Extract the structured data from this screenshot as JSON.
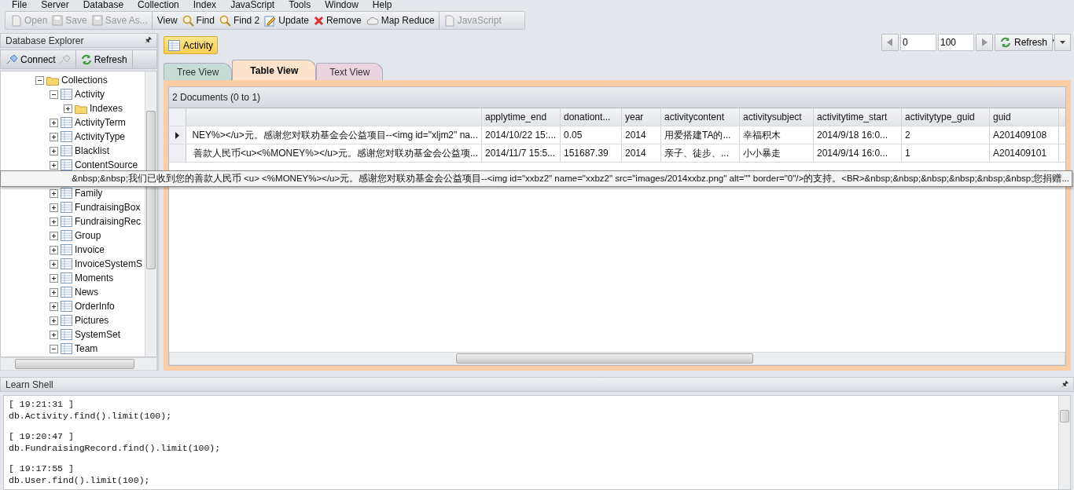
{
  "menu": [
    "File",
    "Server",
    "Database",
    "Collection",
    "Index",
    "JavaScript",
    "Tools",
    "Window",
    "Help"
  ],
  "toolbar": [
    {
      "label": "Open",
      "kind": "page",
      "disabled": true,
      "separator": false
    },
    {
      "label": "Save",
      "kind": "disk",
      "disabled": true,
      "separator": false
    },
    {
      "label": "Save As...",
      "kind": "disk",
      "disabled": true,
      "separator": false
    },
    {
      "label": "View",
      "kind": "text",
      "disabled": false,
      "separator": true
    },
    {
      "label": "Find",
      "kind": "search",
      "disabled": false,
      "separator": false
    },
    {
      "label": "Find 2",
      "kind": "search",
      "disabled": false,
      "separator": false
    },
    {
      "label": "Update",
      "kind": "edit",
      "disabled": false,
      "separator": false
    },
    {
      "label": "Remove",
      "kind": "cross",
      "disabled": false,
      "separator": false
    },
    {
      "label": "Map Reduce",
      "kind": "cloud",
      "disabled": false,
      "separator": false
    },
    {
      "label": "JavaScript",
      "kind": "page",
      "disabled": true,
      "separator": true
    }
  ],
  "explorer": {
    "title": "Database Explorer",
    "pin": "🖈",
    "connect": "Connect",
    "refresh": "Refresh",
    "tree": [
      {
        "label": "Collections",
        "kind": "folder",
        "expanded": true,
        "children": [
          {
            "label": "Activity",
            "kind": "table",
            "expanded": true,
            "children": [
              {
                "label": "Indexes",
                "kind": "folder",
                "expanded": false
              }
            ]
          },
          {
            "label": "ActivityTerm",
            "kind": "table",
            "expanded": false
          },
          {
            "label": "ActivityType",
            "kind": "table",
            "expanded": false
          },
          {
            "label": "Blacklist",
            "kind": "table",
            "expanded": false
          },
          {
            "label": "ContentSource",
            "kind": "table",
            "expanded": false
          },
          {
            "kind": "covered"
          },
          {
            "label": "Family",
            "kind": "table",
            "expanded": false
          },
          {
            "label": "FundraisingBox",
            "kind": "table",
            "expanded": false
          },
          {
            "label": "FundraisingRec",
            "kind": "table",
            "expanded": false
          },
          {
            "label": "Group",
            "kind": "table",
            "expanded": false
          },
          {
            "label": "Invoice",
            "kind": "table",
            "expanded": false
          },
          {
            "label": "InvoiceSystemS",
            "kind": "table",
            "expanded": false
          },
          {
            "label": "Moments",
            "kind": "table",
            "expanded": false
          },
          {
            "label": "News",
            "kind": "table",
            "expanded": false
          },
          {
            "label": "OrderInfo",
            "kind": "table",
            "expanded": false
          },
          {
            "label": "Pictures",
            "kind": "table",
            "expanded": false
          },
          {
            "label": "SystemSet",
            "kind": "table",
            "expanded": false
          },
          {
            "label": "Team",
            "kind": "table",
            "expanded": true
          }
        ]
      }
    ]
  },
  "document_tab": {
    "label": "Activity"
  },
  "view_tabs": [
    {
      "label": "Tree View",
      "selected": false,
      "color": "#c5ddd5"
    },
    {
      "label": "Table View",
      "selected": true,
      "color": "#fde3cc"
    },
    {
      "label": "Text View",
      "selected": false,
      "color": "#ecd3e0"
    }
  ],
  "paging": {
    "skip": "0",
    "limit": "100",
    "refresh": "Refresh"
  },
  "table": {
    "caption": "2 Documents (0 to 1)",
    "columns": [
      "",
      "applytime_end",
      "donationt...",
      "year",
      "activitycontent",
      "activitysubject",
      "activitytime_start",
      "activitytype_guid",
      "guid"
    ],
    "rows": [
      {
        "selected": true,
        "cells": [
          "NEY%></u>元。感谢您对联劝基金会公益项目--<img id=\"xljm2\" na...",
          "2014/10/22 15:...",
          "0.05",
          "2014",
          "用爱搭建TA的...",
          "幸福积木",
          "2014/9/18 16:0...",
          "2",
          "A201409108"
        ]
      },
      {
        "selected": false,
        "cells": [
          "善款人民币<u><%MONEY%></u>元。感谢您对联劝基金会公益项...",
          "2014/11/7 15:5...",
          "151687.39",
          "2014",
          "亲子、徒步、...",
          "小小暴走",
          "2014/9/14 16:0...",
          "1",
          "A201409101"
        ]
      }
    ]
  },
  "tooltip": "&nbsp;&nbsp;我们已收到您的善款人民币 <u> <%MONEY%></u>元。感谢您对联劝基金会公益项目--<img id=\"xxbz2\" name=\"xxbz2\" src=\"images/2014xxbz.png\" alt=\"\" border=\"0\"/>的支持。<BR>&nbsp;&nbsp;&nbsp;&nbsp;&nbsp;&nbsp;您捐赠...",
  "shell": {
    "title": "Learn Shell",
    "entries": [
      {
        "time": "[ 19:21:31 ]",
        "command": "db.Activity.find().limit(100);"
      },
      {
        "time": "[ 19:20:47 ]",
        "command": "db.FundraisingRecord.find().limit(100);"
      },
      {
        "time": "[ 19:17:55 ]",
        "command": "db.User.find().limit(100);"
      }
    ]
  }
}
